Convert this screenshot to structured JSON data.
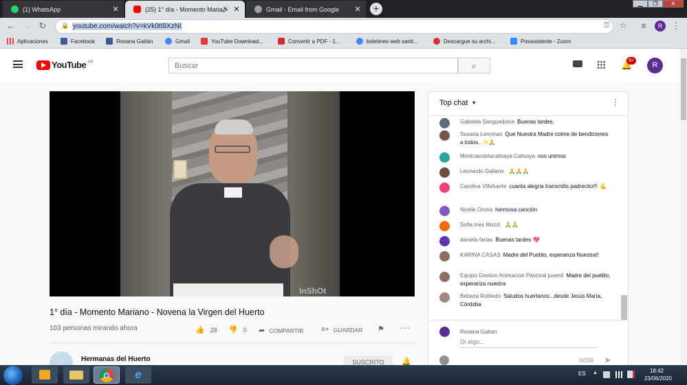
{
  "browser": {
    "tabs": [
      {
        "title": "(1) WhatsApp",
        "favicon_color": "#25d366",
        "active": false
      },
      {
        "title": "(25) 1° día - Momento Maria",
        "favicon_color": "#ff0000",
        "active": true
      },
      {
        "title": "Gmail - Email from Google",
        "favicon_color": "#aaaaaa",
        "active": false
      }
    ],
    "new_tab": "+",
    "url": "youtube.com/watch?v=kVk0tI9XzNI",
    "profile_initial": "R",
    "bookmarks": [
      {
        "label": "Aplicaciones",
        "color": "#e8453c"
      },
      {
        "label": "Facebook",
        "color": "#3b5998"
      },
      {
        "label": "Roxana Gaitán",
        "color": "#3b5998"
      },
      {
        "label": "Gmail",
        "color": "#4285f4"
      },
      {
        "label": "YouTube Download...",
        "color": "#e53935"
      },
      {
        "label": "Convertir a PDF - 1...",
        "color": "#d32f2f"
      },
      {
        "label": "boletines web santi...",
        "color": "#4285f4"
      },
      {
        "label": "Descargue su archi...",
        "color": "#d32f2f"
      },
      {
        "label": "Posasistente - Zoom",
        "color": "#2d8cff"
      }
    ]
  },
  "youtube": {
    "logo_text": "YouTube",
    "logo_region": "AR",
    "search_placeholder": "Buscar",
    "notification_count": "9+",
    "avatar_initial": "R",
    "video": {
      "watermark": "InShOt",
      "title": "1° día - Momento Mariano - Novena la Virgen del Huerto",
      "viewers": "103 personas mirando ahora",
      "likes": "28",
      "dislikes": "0",
      "share_label": "COMPARTIR",
      "save_label": "GUARDAR"
    },
    "channel": {
      "name": "Hermanas del Huerto",
      "subscribe_label": "SUSCRITO"
    },
    "chat": {
      "header": "Top chat",
      "messages": [
        {
          "author": "Gabriela Sanguedolce",
          "text": "Buenas tardes.",
          "color": "#5f6b7a",
          "emoji": ""
        },
        {
          "author": "Susana Lencinas",
          "text": "Que Nuestra Madre colme de bendiciones a todos.",
          "color": "#795548",
          "emoji": "✨🙏"
        },
        {
          "author": "Monicaestelacalisaya Calisaya",
          "text": "nos unimos",
          "color": "#26a69a",
          "emoji": ""
        },
        {
          "author": "Leonardo Galiano",
          "text": "",
          "color": "#6d4c41",
          "emoji": "🙏🙏🙏"
        },
        {
          "author": "Carolina Villafuerte",
          "text": "cuanta alegria transmitis padrecito!!!",
          "color": "#ec407a",
          "emoji": "💪"
        },
        {
          "author": "Noelia Orona",
          "text": "hermosa canción",
          "color": "#7e57c2",
          "emoji": ""
        },
        {
          "author": "Sofia ines Mozzi",
          "text": "",
          "color": "#ef6c00",
          "emoji": "🙏🙏"
        },
        {
          "author": "daniela farias",
          "text": "Buenas tardes",
          "color": "#5e35b1",
          "emoji": "💖"
        },
        {
          "author": "KARINA CASAS",
          "text": "Madre del Pueblo, esperanza Nuestra!!",
          "color": "#8d6e63",
          "emoji": ""
        },
        {
          "author": "Equipo Gestion Animacion Pastoral juvenil",
          "text": "Madre del pueblo, esperanza nuestra",
          "color": "#8d6e63",
          "emoji": ""
        },
        {
          "author": "Betiana Robledo",
          "text": "Saludos huertanos...desde Jesús María, Córdoba",
          "color": "#a1887f",
          "emoji": ""
        }
      ],
      "input_author": "Rosana Gaitan",
      "input_placeholder": "Di algo...",
      "char_count": "0/200"
    }
  },
  "taskbar": {
    "language": "ES",
    "time": "18:42",
    "date": "23/06/2020"
  }
}
